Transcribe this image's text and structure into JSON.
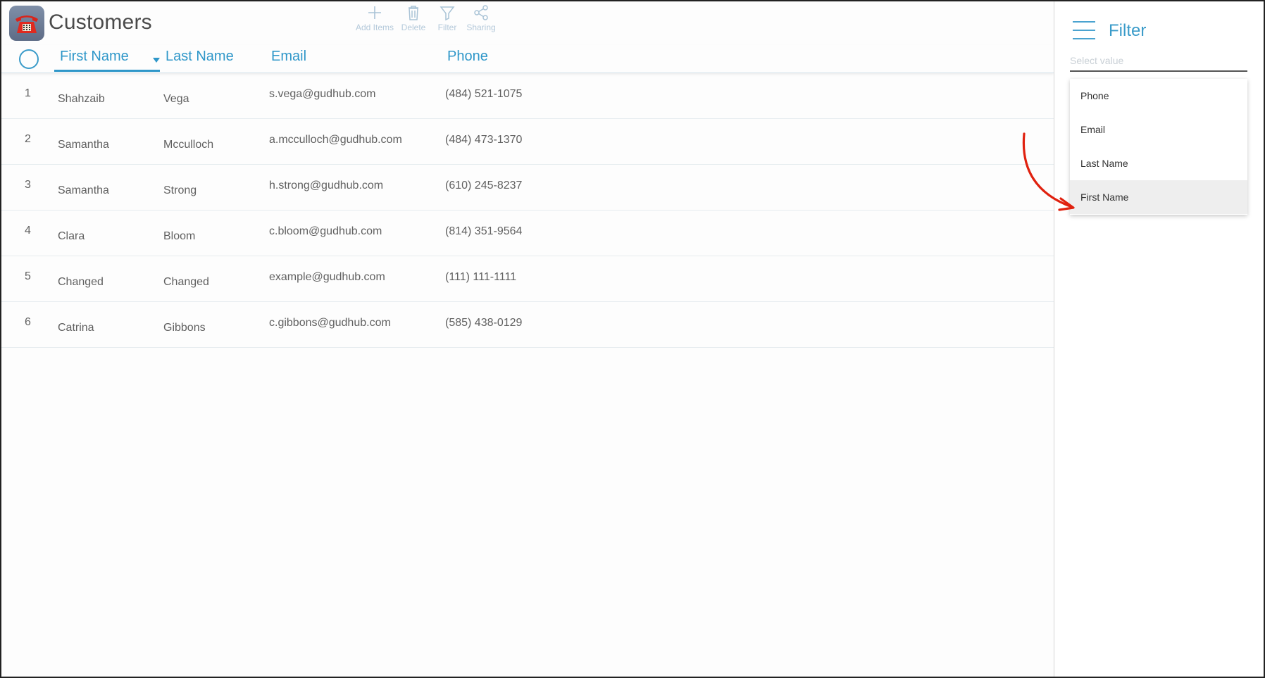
{
  "header": {
    "title": "Customers",
    "toolbar": [
      {
        "icon": "plus-icon",
        "label": "Add Items"
      },
      {
        "icon": "trash-icon",
        "label": "Delete"
      },
      {
        "icon": "filter-icon",
        "label": "Filter"
      },
      {
        "icon": "share-icon",
        "label": "Sharing"
      }
    ]
  },
  "table": {
    "columns": [
      "First Name",
      "Last Name",
      "Email",
      "Phone"
    ],
    "sorted_column": "First Name",
    "rows": [
      {
        "num": "1",
        "first": "Shahzaib",
        "last": "Vega",
        "email": "s.vega@gudhub.com",
        "phone": "(484) 521-1075"
      },
      {
        "num": "2",
        "first": "Samantha",
        "last": "Mcculloch",
        "email": "a.mcculloch@gudhub.com",
        "phone": "(484) 473-1370"
      },
      {
        "num": "3",
        "first": "Samantha",
        "last": "Strong",
        "email": "h.strong@gudhub.com",
        "phone": "(610) 245-8237"
      },
      {
        "num": "4",
        "first": "Clara",
        "last": "Bloom",
        "email": "c.bloom@gudhub.com",
        "phone": "(814) 351-9564"
      },
      {
        "num": "5",
        "first": "Changed",
        "last": "Changed",
        "email": "example@gudhub.com",
        "phone": "(111) 111-1111"
      },
      {
        "num": "6",
        "first": "Catrina",
        "last": "Gibbons",
        "email": "c.gibbons@gudhub.com",
        "phone": "(585) 438-0129"
      }
    ]
  },
  "filter_panel": {
    "title": "Filter",
    "select_placeholder": "Select value",
    "options": [
      "Phone",
      "Email",
      "Last Name",
      "First Name"
    ],
    "highlighted_option": "First Name"
  },
  "colors": {
    "accent": "#2f97c9",
    "annotation_arrow": "#e0210f"
  }
}
